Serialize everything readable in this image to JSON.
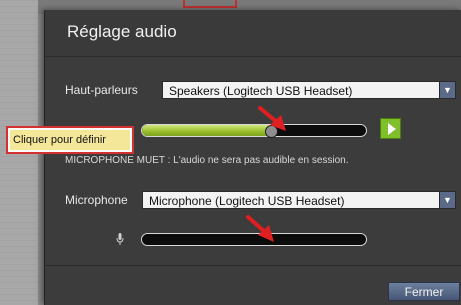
{
  "dialog": {
    "title": "Réglage audio",
    "close_label": "Fermer"
  },
  "speakers": {
    "label": "Haut-parleurs",
    "selected": "Speakers (Logitech USB Headset)",
    "volume_fraction": 0.58
  },
  "tooltip": {
    "text": "Cliquer pour définir"
  },
  "mute_note": "MICROPHONE MUET : L'audio ne sera pas audible en session.",
  "microphone": {
    "label": "Microphone",
    "selected": "Microphone (Logitech USB Headset)",
    "level_fraction": 0
  },
  "colors": {
    "annotation_red": "#e02020",
    "slider_green": "#9cc02e",
    "button_blue": "#5a6a88"
  },
  "icons": {
    "speaker_test": "play-icon",
    "mic": "microphone-icon",
    "dropdown": "chevron-down-icon",
    "annotation": "arrow-icon"
  }
}
